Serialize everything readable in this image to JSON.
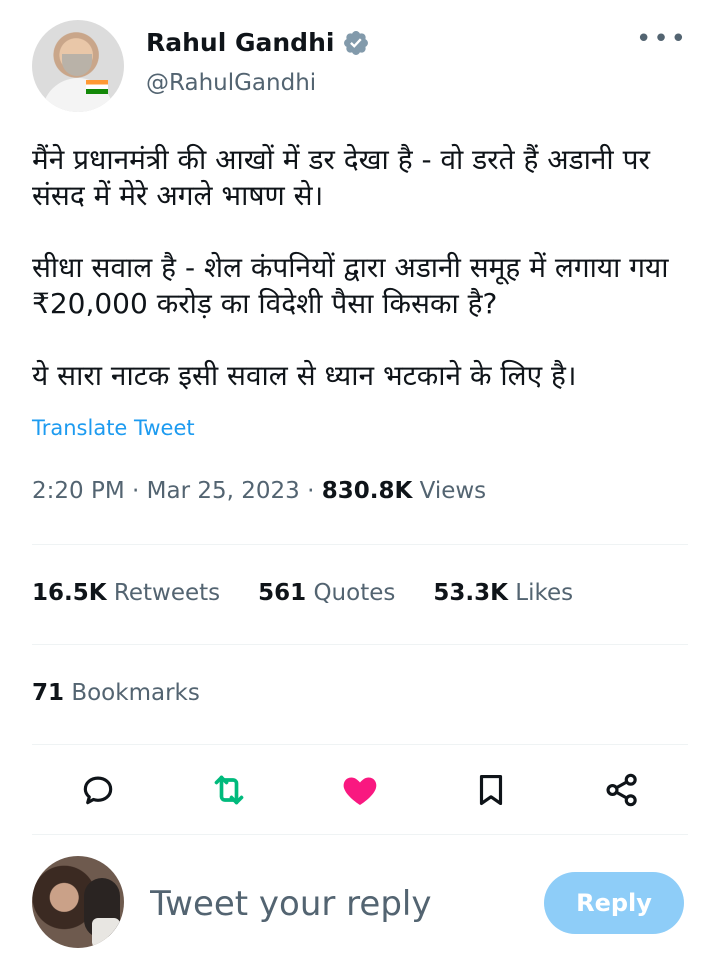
{
  "author": {
    "name": "Rahul Gandhi",
    "handle": "@RahulGandhi",
    "verified_icon": "verified-badge-icon",
    "more_icon": "more-options-icon",
    "more_label": "•••"
  },
  "tweet": {
    "paragraphs": [
      "मैंने प्रधानमंत्री की आखों में डर देखा है - वो डरते हैं अडानी पर संसद में मेरे अगले भाषण से।",
      "सीधा सवाल है - शेल कंपनियों द्वारा अडानी समूह में लगाया गया ₹20,000 करोड़ का विदेशी पैसा किसका है?",
      "ये सारा नाटक इसी सवाल से ध्यान भटकाने के लिए है।"
    ],
    "translate_label": "Translate Tweet"
  },
  "meta": {
    "time": "2:20 PM",
    "date": "Mar 25, 2023",
    "views_count": "830.8K",
    "views_label": "Views",
    "separator": "·"
  },
  "stats": {
    "retweets_count": "16.5K",
    "retweets_label": "Retweets",
    "quotes_count": "561",
    "quotes_label": "Quotes",
    "likes_count": "53.3K",
    "likes_label": "Likes",
    "bookmarks_count": "71",
    "bookmarks_label": "Bookmarks"
  },
  "actions": {
    "icons": [
      "reply-icon",
      "retweet-icon",
      "like-icon",
      "bookmark-icon",
      "share-icon"
    ],
    "colors": {
      "retweet": "#00ba7c",
      "like": "#f91880",
      "neutral": "#536471"
    }
  },
  "reply": {
    "placeholder": "Tweet your reply",
    "button_label": "Reply",
    "button_color": "#8ecdf8"
  }
}
